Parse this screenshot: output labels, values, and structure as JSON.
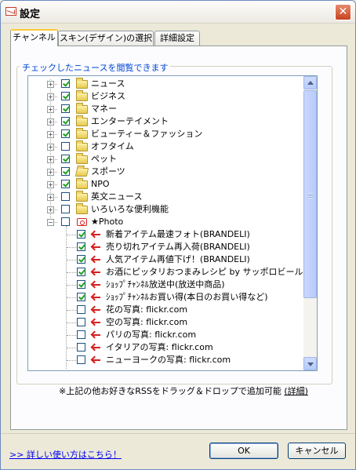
{
  "window": {
    "title": "設定"
  },
  "tabs": [
    {
      "label": "チャンネル",
      "active": true
    },
    {
      "label": "スキン(デザイン)の選択",
      "active": false
    },
    {
      "label": "詳細設定",
      "active": false
    }
  ],
  "group": {
    "legend": "チェックしたニュースを閲覧できます"
  },
  "tree": {
    "items": [
      {
        "label": "ニュース",
        "checked": true,
        "icon": "folder-icon"
      },
      {
        "label": "ビジネス",
        "checked": true,
        "icon": "folder-icon"
      },
      {
        "label": "マネー",
        "checked": true,
        "icon": "folder-icon"
      },
      {
        "label": "エンターテイメント",
        "checked": true,
        "icon": "folder-icon"
      },
      {
        "label": "ビューティー＆ファッション",
        "checked": true,
        "icon": "folder-icon"
      },
      {
        "label": "オフタイム",
        "checked": false,
        "icon": "folder-icon"
      },
      {
        "label": "ペット",
        "checked": true,
        "icon": "folder-icon"
      },
      {
        "label": "スポーツ",
        "checked": true,
        "icon": "folder-open-icon"
      },
      {
        "label": "NPO",
        "checked": true,
        "icon": "folder-icon"
      },
      {
        "label": "英文ニュース",
        "checked": false,
        "icon": "folder-icon"
      },
      {
        "label": "いろいろな便利機能",
        "checked": false,
        "icon": "folder-icon"
      },
      {
        "label": "★Photo",
        "checked": false,
        "icon": "camera-icon",
        "expanded": true
      }
    ],
    "photo_children": [
      {
        "label": "新着アイテム最速フォト(BRANDELI)",
        "checked": true
      },
      {
        "label": "売り切れアイテム再入荷(BRANDELI)",
        "checked": true
      },
      {
        "label": "人気アイテム再値下げ！(BRANDELI)",
        "checked": true
      },
      {
        "label": "お酒にピッタリおつまみレシピ by サッポロビール",
        "checked": true
      },
      {
        "label": "ｼｮｯﾌﾟﾁｬﾝﾈﾙ放送中(放送中商品)",
        "checked": true
      },
      {
        "label": "ｼｮｯﾌﾟﾁｬﾝﾈﾙお買い得(本日のお買い得など)",
        "checked": true
      },
      {
        "label": "花の写真: flickr.com",
        "checked": false
      },
      {
        "label": "空の写真: flickr.com",
        "checked": false
      },
      {
        "label": "パリの写真: flickr.com",
        "checked": false
      },
      {
        "label": "イタリアの写真: flickr.com",
        "checked": false
      },
      {
        "label": "ニューヨークの写真: flickr.com",
        "checked": false
      }
    ]
  },
  "note": {
    "text": "※上記の他お好きなRSSをドラッグ＆ドロップで追加可能",
    "link": "(詳細)"
  },
  "footer": {
    "help_link": ">> 詳しい使い方はこちら！",
    "ok_label": "OK",
    "cancel_label": "キャンセル"
  }
}
